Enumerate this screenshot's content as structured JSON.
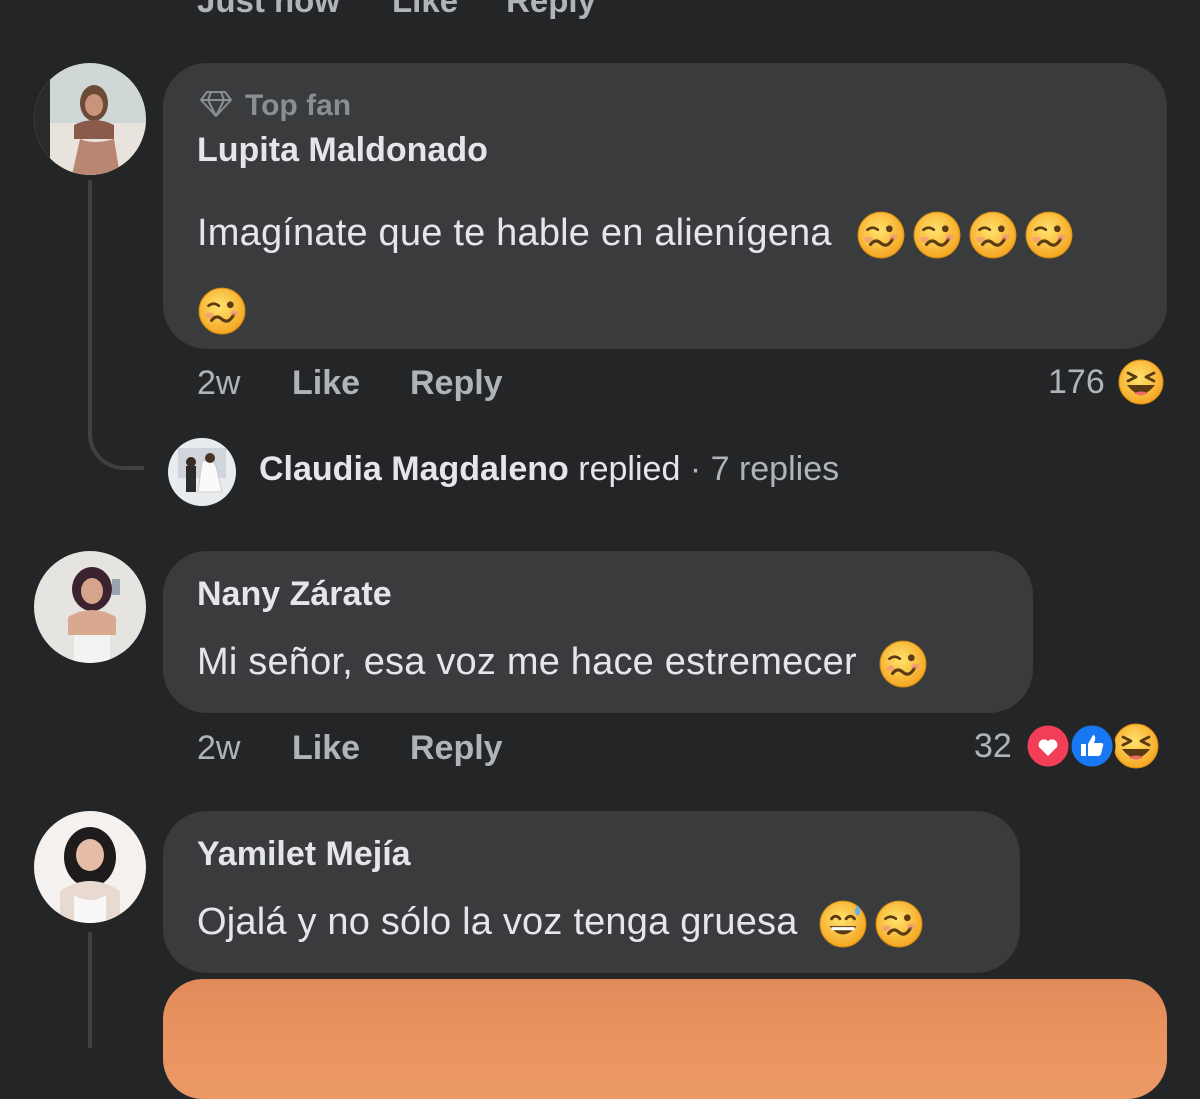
{
  "top_actions": {
    "time": "Just now",
    "like": "Like",
    "reply": "Reply"
  },
  "comments": [
    {
      "badge": "Top fan",
      "author": "Lupita Maldonado",
      "text": "Imagínate que te hable en alienígena",
      "emoji_names": [
        "woozy-face",
        "woozy-face",
        "woozy-face",
        "woozy-face",
        "woozy-face"
      ],
      "time": "2w",
      "like": "Like",
      "reply": "Reply",
      "reaction_count": "176",
      "reactions": [
        "haha"
      ],
      "reply_summary": {
        "author": "Claudia Magdaleno",
        "verb": "replied",
        "sep": "·",
        "count": "7 replies"
      }
    },
    {
      "author": "Nany Zárate",
      "text": "Mi señor, esa voz me hace estremecer",
      "emoji_names": [
        "woozy-face"
      ],
      "time": "2w",
      "like": "Like",
      "reply": "Reply",
      "reaction_count": "32",
      "reactions": [
        "love",
        "like",
        "haha"
      ]
    },
    {
      "author": "Yamilet Mejía",
      "text": "Ojalá y no sólo la voz tenga gruesa",
      "emoji_names": [
        "grinning-sweat-face",
        "woozy-face"
      ]
    }
  ],
  "colors": {
    "background": "#242526",
    "bubble": "#3a3b3c",
    "secondary_text": "#b0b3b8",
    "like_blue": "#1877f2",
    "love_red": "#f33e58",
    "emoji_yellow": "#f7b928"
  }
}
